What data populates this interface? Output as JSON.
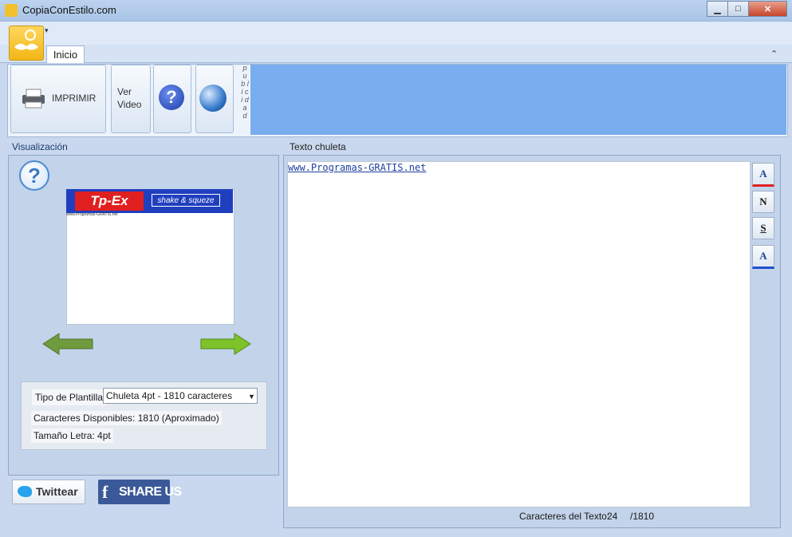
{
  "window": {
    "title": "CopiaConEstilo.com",
    "controls": {
      "minimize": "▁",
      "maximize": "□",
      "close": "✕"
    }
  },
  "ribbon": {
    "qat_arrow": "▾",
    "collapse": "⌃",
    "tabs": [
      {
        "label": "Inicio"
      }
    ],
    "buttons": {
      "print": "IMPRIMIR",
      "video": "Ver Video",
      "help": "?"
    },
    "ad_label": "p u b l i c i d a d"
  },
  "visualizacion": {
    "label": "Visualización",
    "help": "?",
    "preview": {
      "logo_text": "Tp-Ex",
      "tagline": "shake & squeze",
      "body_text": "www.Programas-GRATIS.net"
    },
    "template_label": "Tipo de Plantilla",
    "template_value": "Chuleta 4pt - 1810 caracteres",
    "chars_available": "Caracteres Disponibles: 1810 (Aproximado)",
    "font_size": "Tamaño Letra: 4pt"
  },
  "social": {
    "twitter_label": "Twittear",
    "fb_letter": "f",
    "share_label": "SHARE US"
  },
  "texto": {
    "label": "Texto chuleta",
    "content": "www.Programas-GRATIS.net",
    "format_buttons": [
      "A",
      "N",
      "S",
      "A"
    ],
    "count_label": "Caracteres del Texto:",
    "count_value": "24",
    "count_max": "/1810"
  },
  "colors": {
    "ribbon_blue": "#78adef",
    "panel": "#c2d3ea",
    "facebook": "#3b5998",
    "twitter": "#2aa3ee"
  }
}
